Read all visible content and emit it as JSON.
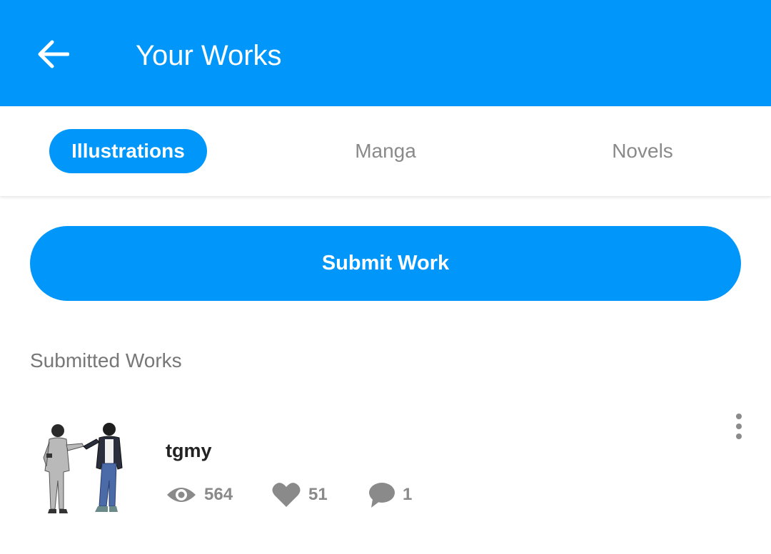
{
  "header": {
    "title": "Your Works",
    "back_icon": "arrow-left-icon",
    "background_color": "#0096fa"
  },
  "tabs": [
    {
      "label": "Illustrations",
      "active": true
    },
    {
      "label": "Manga",
      "active": false
    },
    {
      "label": "Novels",
      "active": false
    }
  ],
  "submit_button": {
    "label": "Submit Work"
  },
  "section": {
    "title": "Submitted Works"
  },
  "works": [
    {
      "title": "tgmy",
      "views": "564",
      "likes": "51",
      "comments": "1",
      "icons": [
        "eye-icon",
        "heart-icon",
        "comment-icon",
        "more-vertical-icon"
      ]
    }
  ],
  "colors": {
    "accent": "#0096fa",
    "muted_text": "#8a8a8a"
  }
}
